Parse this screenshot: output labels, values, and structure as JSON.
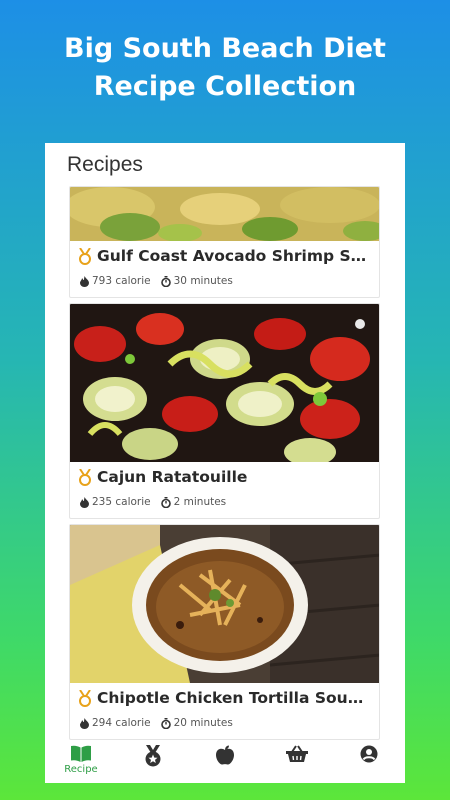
{
  "promo": {
    "title_line1": "Big South Beach Diet",
    "title_line2": "Recipe Collection"
  },
  "screen": {
    "title": "Recipes"
  },
  "recipes": [
    {
      "title": "Gulf Coast Avocado Shrimp Sa...",
      "calories": "793 calorie",
      "time": "30 minutes"
    },
    {
      "title": "Cajun Ratatouille",
      "calories": "235 calorie",
      "time": "2 minutes"
    },
    {
      "title": "Chipotle Chicken Tortilla Soup...",
      "calories": "294 calorie",
      "time": "20 minutes"
    }
  ],
  "tabbar": {
    "items": [
      {
        "icon": "book-icon",
        "label": "Recipe",
        "active": true
      },
      {
        "icon": "medal-icon",
        "label": "",
        "active": false
      },
      {
        "icon": "apple-icon",
        "label": "",
        "active": false
      },
      {
        "icon": "basket-icon",
        "label": "",
        "active": false
      },
      {
        "icon": "profile-icon",
        "label": "",
        "active": false
      }
    ]
  },
  "colors": {
    "accent": "#2e9e46",
    "medal": "#e8a21a"
  }
}
